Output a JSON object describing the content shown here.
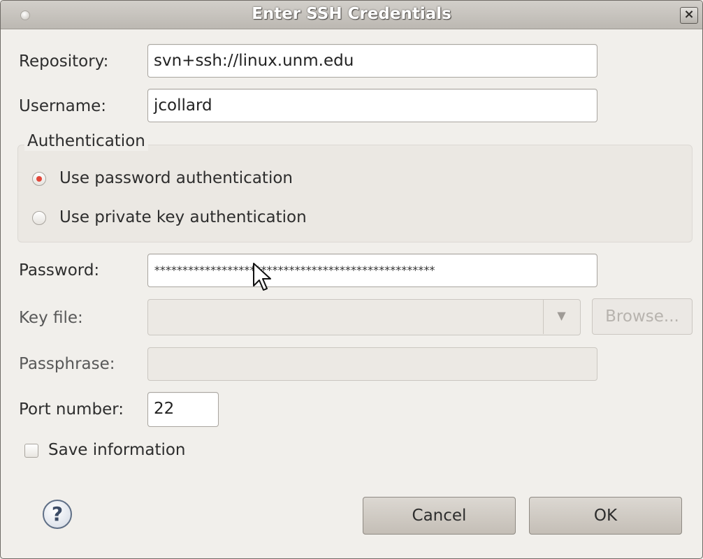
{
  "window": {
    "title": "Enter SSH Credentials",
    "close_glyph": "×"
  },
  "repository": {
    "label": "Repository:",
    "value": "svn+ssh://linux.unm.edu"
  },
  "username": {
    "label": "Username:",
    "value": "jcollard"
  },
  "authentication": {
    "group_label": "Authentication",
    "options": [
      {
        "label": "Use password authentication",
        "checked": true
      },
      {
        "label": "Use private key authentication",
        "checked": false
      }
    ]
  },
  "password": {
    "label": "Password:",
    "value": "**************************************************"
  },
  "key_file": {
    "label": "Key file:",
    "value": "",
    "arrow_glyph": "▼",
    "browse_label": "Browse..."
  },
  "passphrase": {
    "label": "Passphrase:",
    "value": ""
  },
  "port": {
    "label": "Port number:",
    "value": "22"
  },
  "save_information": {
    "label": "Save information",
    "checked": false
  },
  "buttons": {
    "help_glyph": "?",
    "cancel_label": "Cancel",
    "ok_label": "OK"
  },
  "icons": {
    "help": "help-icon",
    "close": "close-icon",
    "cursor": "mouse-cursor-icon"
  },
  "colors": {
    "radio_selected": "#e2473a",
    "window_background": "#f1efeb"
  }
}
